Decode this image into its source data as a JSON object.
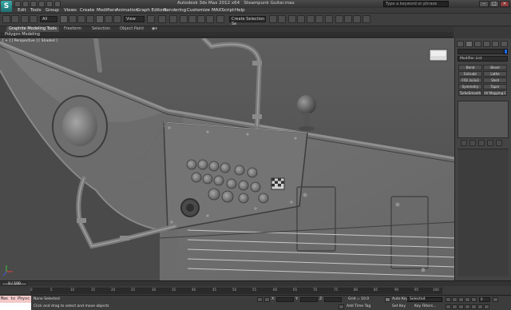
{
  "title": {
    "app_name": "Autodesk 3ds Max  2012 x64",
    "file_name": "Steampunk Guitar.max",
    "search_placeholder": "Type a keyword or phrase"
  },
  "menu": [
    "Edit",
    "Tools",
    "Group",
    "Views",
    "Create",
    "Modifiers",
    "Animation",
    "Graph Editors",
    "Rendering",
    "Customize",
    "MAXScript",
    "Help"
  ],
  "toolbar": {
    "selection_filter": "All",
    "reference_coord": "View",
    "named_selection": "Create Selection Se"
  },
  "ribbon": {
    "tabs": [
      "Graphite Modeling Tools",
      "Freeform",
      "Selection",
      "Object Paint"
    ],
    "panel_label": "Polygon Modeling"
  },
  "viewport": {
    "label": "[ + ] [ Perspective ] [ Shaded ]"
  },
  "command_panel": {
    "modifier_list": "Modifier List",
    "buttons": [
      "Bend",
      "Bevel",
      "Extrude",
      "Lathe",
      "FFD 3x3x3",
      "Shell",
      "Symmetry",
      "Taper",
      "TurboSmooth",
      "UV Mapping Cl"
    ]
  },
  "timeline": {
    "frame_display": "0 / 100",
    "ticks": [
      "0",
      "5",
      "10",
      "15",
      "20",
      "25",
      "30",
      "35",
      "40",
      "45",
      "50",
      "55",
      "60",
      "65",
      "70",
      "75",
      "80",
      "85",
      "90",
      "95",
      "100"
    ]
  },
  "status": {
    "maxscript_label": "Max to Physc",
    "selection_status": "None Selected",
    "prompt": "Click and drag to select and move objects",
    "x_label": "X:",
    "y_label": "Y:",
    "z_label": "Z:",
    "grid": "Grid = 10.0",
    "add_time_tag": "Add Time Tag",
    "auto_key": "Auto Key",
    "auto_key_value": "Selected",
    "set_key": "Set Key",
    "key_filters": "Key Filters...",
    "frame_value": "0"
  },
  "colors": {
    "object_color": "#1a6bff",
    "maxscript_bg": "#f3c8c8",
    "viewport_bg": "#555555"
  }
}
